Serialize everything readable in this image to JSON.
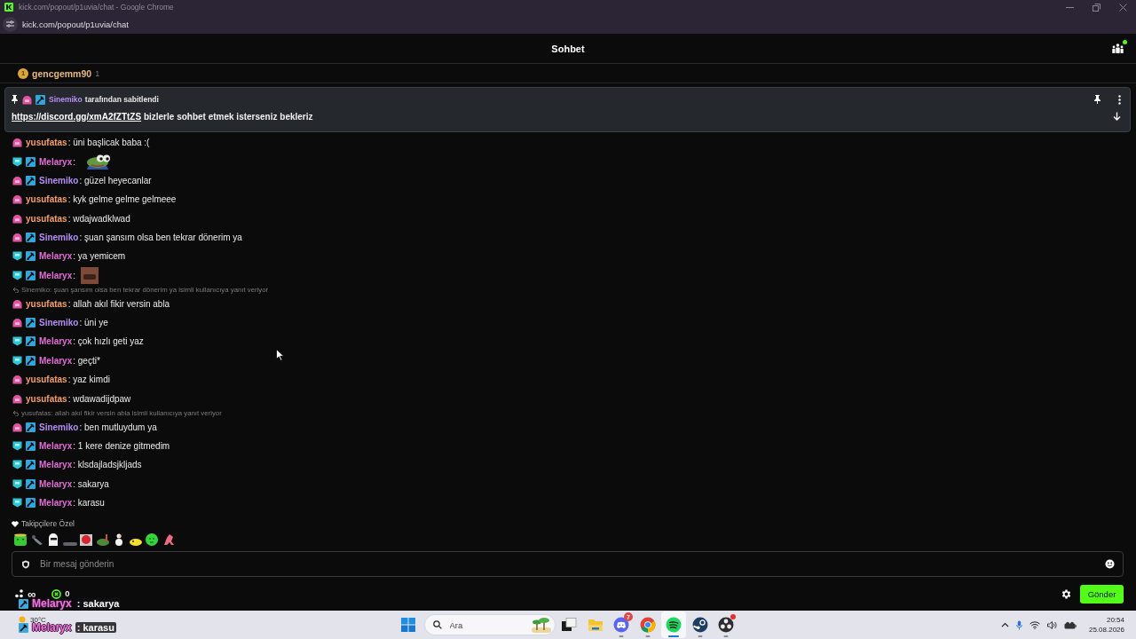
{
  "browser": {
    "title": "kick.com/popout/p1uvia/chat - Google Chrome",
    "url": "kick.com/popout/p1uvia/chat"
  },
  "chat_header": {
    "title": "Sohbet",
    "live": true
  },
  "leaderboard": [
    {
      "rank": "1",
      "user": "gencgemm90",
      "count": "1"
    }
  ],
  "pinned": {
    "user": "Sinemiko",
    "color": "#b48df6",
    "badges": [
      {
        "kind": "dome"
      },
      {
        "kind": "moderator"
      }
    ],
    "note": "tarafından sabitlendi",
    "link": "https://discord.gg/xmA2fZTtZS",
    "text": "bizlerle sohbet etmek isterseniz bekleriz"
  },
  "messages": [
    {
      "kind": "text",
      "user": "yusufatas",
      "color": "#f49e62",
      "badges": [
        {
          "kind": "dome"
        }
      ],
      "text": ": üni başlicak baba :("
    },
    {
      "kind": "frog",
      "user": "Melaryx",
      "color": "#e36cd6",
      "badges": [
        {
          "kind": "shield"
        },
        {
          "kind": "moderator"
        }
      ],
      "text": ":"
    },
    {
      "kind": "text",
      "user": "Sinemiko",
      "color": "#b48df6",
      "badges": [
        {
          "kind": "dome"
        },
        {
          "kind": "moderator"
        }
      ],
      "text": ": güzel heyecanlar"
    },
    {
      "kind": "text",
      "user": "yusufatas",
      "color": "#f49e62",
      "badges": [
        {
          "kind": "dome"
        }
      ],
      "text": ": kyk gelme gelme gelmeee"
    },
    {
      "kind": "text",
      "user": "yusufatas",
      "color": "#f49e62",
      "badges": [
        {
          "kind": "dome"
        }
      ],
      "text": ": wdajwadklwad"
    },
    {
      "kind": "text",
      "user": "Sinemiko",
      "color": "#b48df6",
      "badges": [
        {
          "kind": "dome"
        },
        {
          "kind": "moderator"
        }
      ],
      "text": ": şuan şansım olsa ben tekrar dönerim ya"
    },
    {
      "kind": "text",
      "user": "Melaryx",
      "color": "#e36cd6",
      "badges": [
        {
          "kind": "shield"
        },
        {
          "kind": "moderator"
        }
      ],
      "text": ": ya yemicem"
    },
    {
      "kind": "picture",
      "user": "Melaryx",
      "color": "#e36cd6",
      "badges": [
        {
          "kind": "shield"
        },
        {
          "kind": "moderator"
        }
      ],
      "text": ":"
    },
    {
      "kind": "reply",
      "text": "Sinemiko: şuan şansım olsa ben tekrar dönerim ya isimli kullanıcıya yanıt veriyor"
    },
    {
      "kind": "text",
      "user": "yusufatas",
      "color": "#f49e62",
      "badges": [
        {
          "kind": "dome"
        }
      ],
      "text": ": allah akıl fikir versin abla"
    },
    {
      "kind": "text",
      "user": "Sinemiko",
      "color": "#b48df6",
      "badges": [
        {
          "kind": "dome"
        },
        {
          "kind": "moderator"
        }
      ],
      "text": ": üni ye"
    },
    {
      "kind": "text",
      "user": "Melaryx",
      "color": "#e36cd6",
      "badges": [
        {
          "kind": "shield"
        },
        {
          "kind": "moderator"
        }
      ],
      "text": ": çok hızlı geti yaz"
    },
    {
      "kind": "text",
      "user": "Melaryx",
      "color": "#e36cd6",
      "badges": [
        {
          "kind": "shield"
        },
        {
          "kind": "moderator"
        }
      ],
      "text": ": geçti*"
    },
    {
      "kind": "text",
      "user": "yusufatas",
      "color": "#f49e62",
      "badges": [
        {
          "kind": "dome"
        }
      ],
      "text": ": yaz kimdi"
    },
    {
      "kind": "text",
      "user": "yusufatas",
      "color": "#f49e62",
      "badges": [
        {
          "kind": "dome"
        }
      ],
      "text": ": wdawadijdpaw"
    },
    {
      "kind": "reply",
      "text": "yusufatas: allah akıl fikir versin abla isimli kullanıcıya yanıt veriyor"
    },
    {
      "kind": "text",
      "user": "Sinemiko",
      "color": "#b48df6",
      "badges": [
        {
          "kind": "dome"
        },
        {
          "kind": "moderator"
        }
      ],
      "text": ": ben mutluydum ya"
    },
    {
      "kind": "text",
      "user": "Melaryx",
      "color": "#e36cd6",
      "badges": [
        {
          "kind": "shield"
        },
        {
          "kind": "moderator"
        }
      ],
      "text": ": 1 kere denize gitmedim"
    },
    {
      "kind": "text",
      "user": "Melaryx",
      "color": "#e36cd6",
      "badges": [
        {
          "kind": "shield"
        },
        {
          "kind": "moderator"
        }
      ],
      "text": ": klsdajladsjkljads"
    },
    {
      "kind": "text",
      "user": "Melaryx",
      "color": "#e36cd6",
      "badges": [
        {
          "kind": "shield"
        },
        {
          "kind": "moderator"
        }
      ],
      "text": ": sakarya"
    },
    {
      "kind": "text",
      "user": "Melaryx",
      "color": "#e36cd6",
      "badges": [
        {
          "kind": "shield"
        },
        {
          "kind": "moderator"
        }
      ],
      "text": ": karasu"
    }
  ],
  "follower_emotes": {
    "label": "Takipçilere Özel"
  },
  "composer": {
    "placeholder": "Bir mesaj gönderin",
    "send": "Gönder"
  },
  "stats": [
    {
      "kind": "slowmode",
      "value": "∞"
    },
    {
      "kind": "points",
      "value": "0"
    }
  ],
  "taskbar": {
    "weather": "30°C",
    "search": {
      "placeholder": "Ara"
    },
    "apps": [
      {
        "kind": "tasks",
        "running": false,
        "active": false
      },
      {
        "kind": "folder",
        "running": false,
        "active": false
      },
      {
        "kind": "chat",
        "running": true,
        "active": false,
        "badge": "7"
      },
      {
        "kind": "browser",
        "running": true,
        "active": false
      },
      {
        "kind": "music",
        "running": true,
        "active": true
      },
      {
        "kind": "games",
        "running": true,
        "active": false
      },
      {
        "kind": "recorder",
        "running": true,
        "active": false,
        "alert": true
      }
    ],
    "time": "20:54",
    "date": "25.08.2026"
  },
  "stream_overlay": [
    {
      "user": "Melaryx",
      "color": "#e87ad9",
      "text": ": sakarya"
    },
    {
      "user": "Melaryx",
      "color": "#e87ad9",
      "text": ": karasu"
    }
  ]
}
